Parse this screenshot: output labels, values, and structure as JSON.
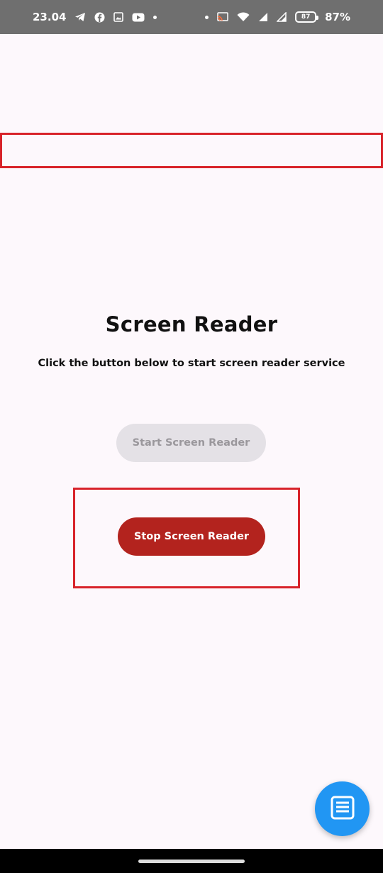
{
  "status_bar": {
    "time": "23.04",
    "left_icons": [
      "telegram-icon",
      "facebook-icon",
      "gallery-icon",
      "youtube-icon",
      "dot-icon"
    ],
    "right_icons": [
      "dot-icon",
      "cast-icon",
      "wifi-icon",
      "signal-icon",
      "signal-icon",
      "battery-icon"
    ],
    "battery_percent": "87%",
    "battery_inner": "87"
  },
  "main": {
    "title": "Screen Reader",
    "subtitle": "Click the button below to start screen reader service",
    "start_button_label": "Start Screen Reader",
    "stop_button_label": "Stop Screen Reader"
  },
  "fab": {
    "icon": "list-icon"
  },
  "colors": {
    "highlight": "#d8232a",
    "stop_button": "#b3231e",
    "start_button_disabled": "#e4e1e6",
    "fab": "#2196f3",
    "background": "#fdf8fc"
  }
}
